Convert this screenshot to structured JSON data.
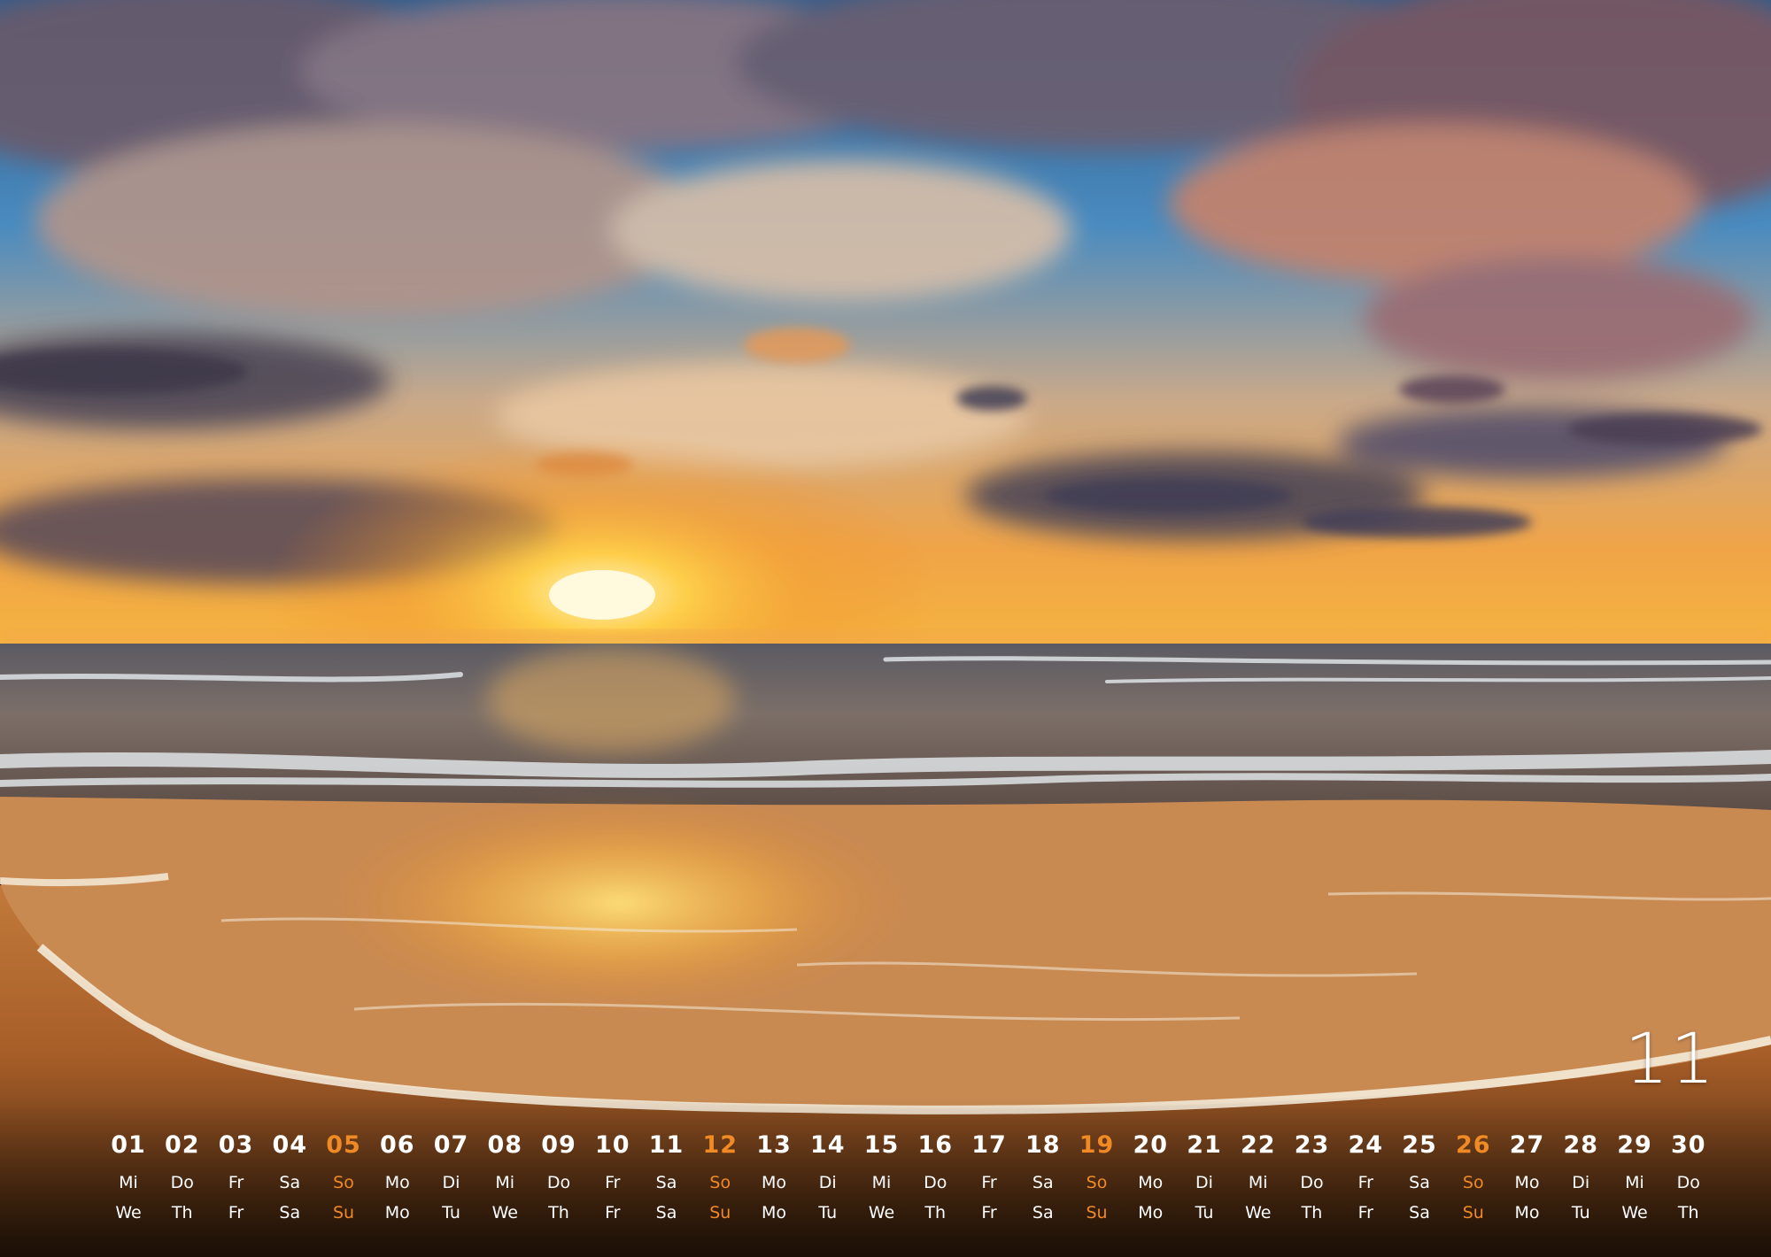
{
  "photo": {
    "subject": "sunset-over-sea-beach-waves",
    "colors": {
      "sky_blue": "#3d8cc8",
      "sun": "#ffd24a",
      "cloud_dark": "#4d4656",
      "sand": "#b8682c",
      "foam": "#f4ead8"
    }
  },
  "calendar": {
    "month_number": "11",
    "accent_color": "#f08a24",
    "days": [
      {
        "num": "01",
        "de": "Mi",
        "en": "We",
        "sunday": false
      },
      {
        "num": "02",
        "de": "Do",
        "en": "Th",
        "sunday": false
      },
      {
        "num": "03",
        "de": "Fr",
        "en": "Fr",
        "sunday": false
      },
      {
        "num": "04",
        "de": "Sa",
        "en": "Sa",
        "sunday": false
      },
      {
        "num": "05",
        "de": "So",
        "en": "Su",
        "sunday": true
      },
      {
        "num": "06",
        "de": "Mo",
        "en": "Mo",
        "sunday": false
      },
      {
        "num": "07",
        "de": "Di",
        "en": "Tu",
        "sunday": false
      },
      {
        "num": "08",
        "de": "Mi",
        "en": "We",
        "sunday": false
      },
      {
        "num": "09",
        "de": "Do",
        "en": "Th",
        "sunday": false
      },
      {
        "num": "10",
        "de": "Fr",
        "en": "Fr",
        "sunday": false
      },
      {
        "num": "11",
        "de": "Sa",
        "en": "Sa",
        "sunday": false
      },
      {
        "num": "12",
        "de": "So",
        "en": "Su",
        "sunday": true
      },
      {
        "num": "13",
        "de": "Mo",
        "en": "Mo",
        "sunday": false
      },
      {
        "num": "14",
        "de": "Di",
        "en": "Tu",
        "sunday": false
      },
      {
        "num": "15",
        "de": "Mi",
        "en": "We",
        "sunday": false
      },
      {
        "num": "16",
        "de": "Do",
        "en": "Th",
        "sunday": false
      },
      {
        "num": "17",
        "de": "Fr",
        "en": "Fr",
        "sunday": false
      },
      {
        "num": "18",
        "de": "Sa",
        "en": "Sa",
        "sunday": false
      },
      {
        "num": "19",
        "de": "So",
        "en": "Su",
        "sunday": true
      },
      {
        "num": "20",
        "de": "Mo",
        "en": "Mo",
        "sunday": false
      },
      {
        "num": "21",
        "de": "Di",
        "en": "Tu",
        "sunday": false
      },
      {
        "num": "22",
        "de": "Mi",
        "en": "We",
        "sunday": false
      },
      {
        "num": "23",
        "de": "Do",
        "en": "Th",
        "sunday": false
      },
      {
        "num": "24",
        "de": "Fr",
        "en": "Fr",
        "sunday": false
      },
      {
        "num": "25",
        "de": "Sa",
        "en": "Sa",
        "sunday": false
      },
      {
        "num": "26",
        "de": "So",
        "en": "Su",
        "sunday": true
      },
      {
        "num": "27",
        "de": "Mo",
        "en": "Mo",
        "sunday": false
      },
      {
        "num": "28",
        "de": "Di",
        "en": "Tu",
        "sunday": false
      },
      {
        "num": "29",
        "de": "Mi",
        "en": "We",
        "sunday": false
      },
      {
        "num": "30",
        "de": "Do",
        "en": "Th",
        "sunday": false
      }
    ]
  }
}
